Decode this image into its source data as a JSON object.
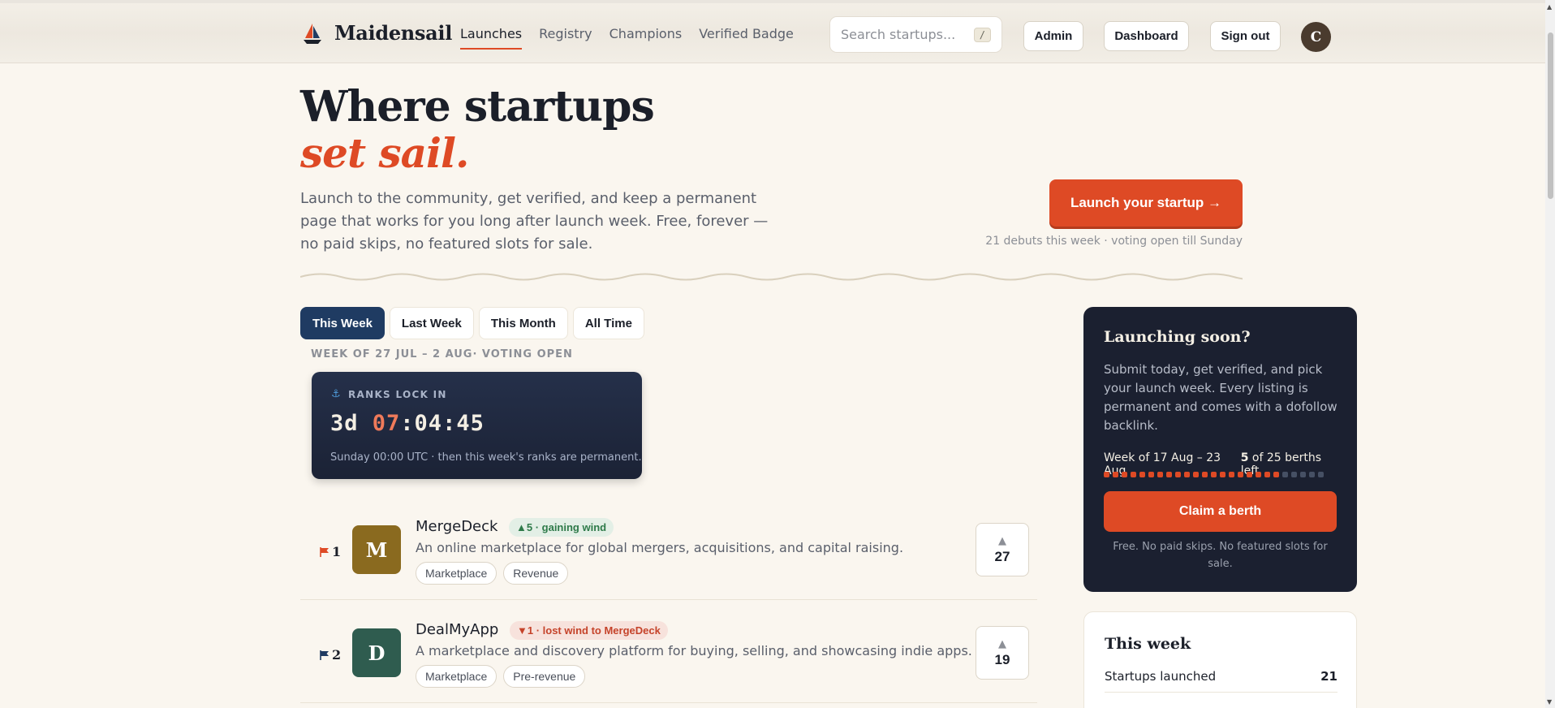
{
  "brand": {
    "name": "Maidensail",
    "logo_icon": "sailboat-icon"
  },
  "nav": {
    "items": [
      {
        "label": "Launches",
        "active": true
      },
      {
        "label": "Registry",
        "active": false
      },
      {
        "label": "Champions",
        "active": false
      },
      {
        "label": "Verified Badge",
        "active": false
      }
    ]
  },
  "search": {
    "placeholder": "Search startups...",
    "shortcut": "/"
  },
  "header_buttons": {
    "admin": "Admin",
    "dashboard": "Dashboard",
    "sign_out": "Sign out"
  },
  "user": {
    "avatar_initial": "C"
  },
  "hero": {
    "title": "Where startups",
    "accent": "set sail.",
    "description": "Launch to the community, get verified, and keep a permanent page that works for you long after launch week. Free, forever — no paid skips, no featured slots for sale.",
    "cta": "Launch your startup →",
    "cta_note": "21 debuts this week · voting open till Sunday"
  },
  "tabs": [
    {
      "label": "This Week",
      "active": true
    },
    {
      "label": "Last Week",
      "active": false
    },
    {
      "label": "This Month",
      "active": false
    },
    {
      "label": "All Time",
      "active": false
    }
  ],
  "week_label": "WEEK OF 27 JUL – 2 AUG· VOTING OPEN",
  "timer": {
    "label": "RANKS LOCK IN",
    "days": "3d",
    "hours": "07",
    "rest": ":04:45",
    "note": "Sunday 00:00 UTC · then this week's ranks are permanent."
  },
  "launches": [
    {
      "rank": "1",
      "flag_color": "#de4a25",
      "initial": "M",
      "logo_color": "#8a6a1f",
      "name": "MergeDeck",
      "momentum": "▲5 · gaining wind",
      "momentum_dir": "up",
      "description": "An online marketplace for global mergers, acquisitions, and capital raising.",
      "tags": [
        "Marketplace",
        "Revenue"
      ],
      "votes": "27"
    },
    {
      "rank": "2",
      "flag_color": "#1f3b62",
      "initial": "D",
      "logo_color": "#2f5c4f",
      "name": "DealMyApp",
      "momentum": "▼1 · lost wind to MergeDeck",
      "momentum_dir": "down",
      "description": "A marketplace and discovery platform for buying, selling, and showcasing indie apps.",
      "tags": [
        "Marketplace",
        "Pre-revenue"
      ],
      "votes": "19"
    }
  ],
  "side": {
    "title": "Launching soon?",
    "description": "Submit today, get verified, and pick your launch week. Every listing is permanent and comes with a dofollow backlink.",
    "week_range": "Week of 17 Aug – 23 Aug",
    "berths_left_count": "5",
    "berths_left_text": " of 25 berths left",
    "berths_total": 25,
    "berths_taken": 20,
    "claim": "Claim a berth",
    "note": "Free. No paid skips. No featured slots for sale."
  },
  "stats": {
    "title": "This week",
    "rows": [
      {
        "label": "Startups launched",
        "value": "21"
      }
    ]
  },
  "colors": {
    "accent": "#de4a25",
    "navy": "#1f3b62",
    "dark_panel": "#1b2030",
    "background": "#faf6ef"
  }
}
